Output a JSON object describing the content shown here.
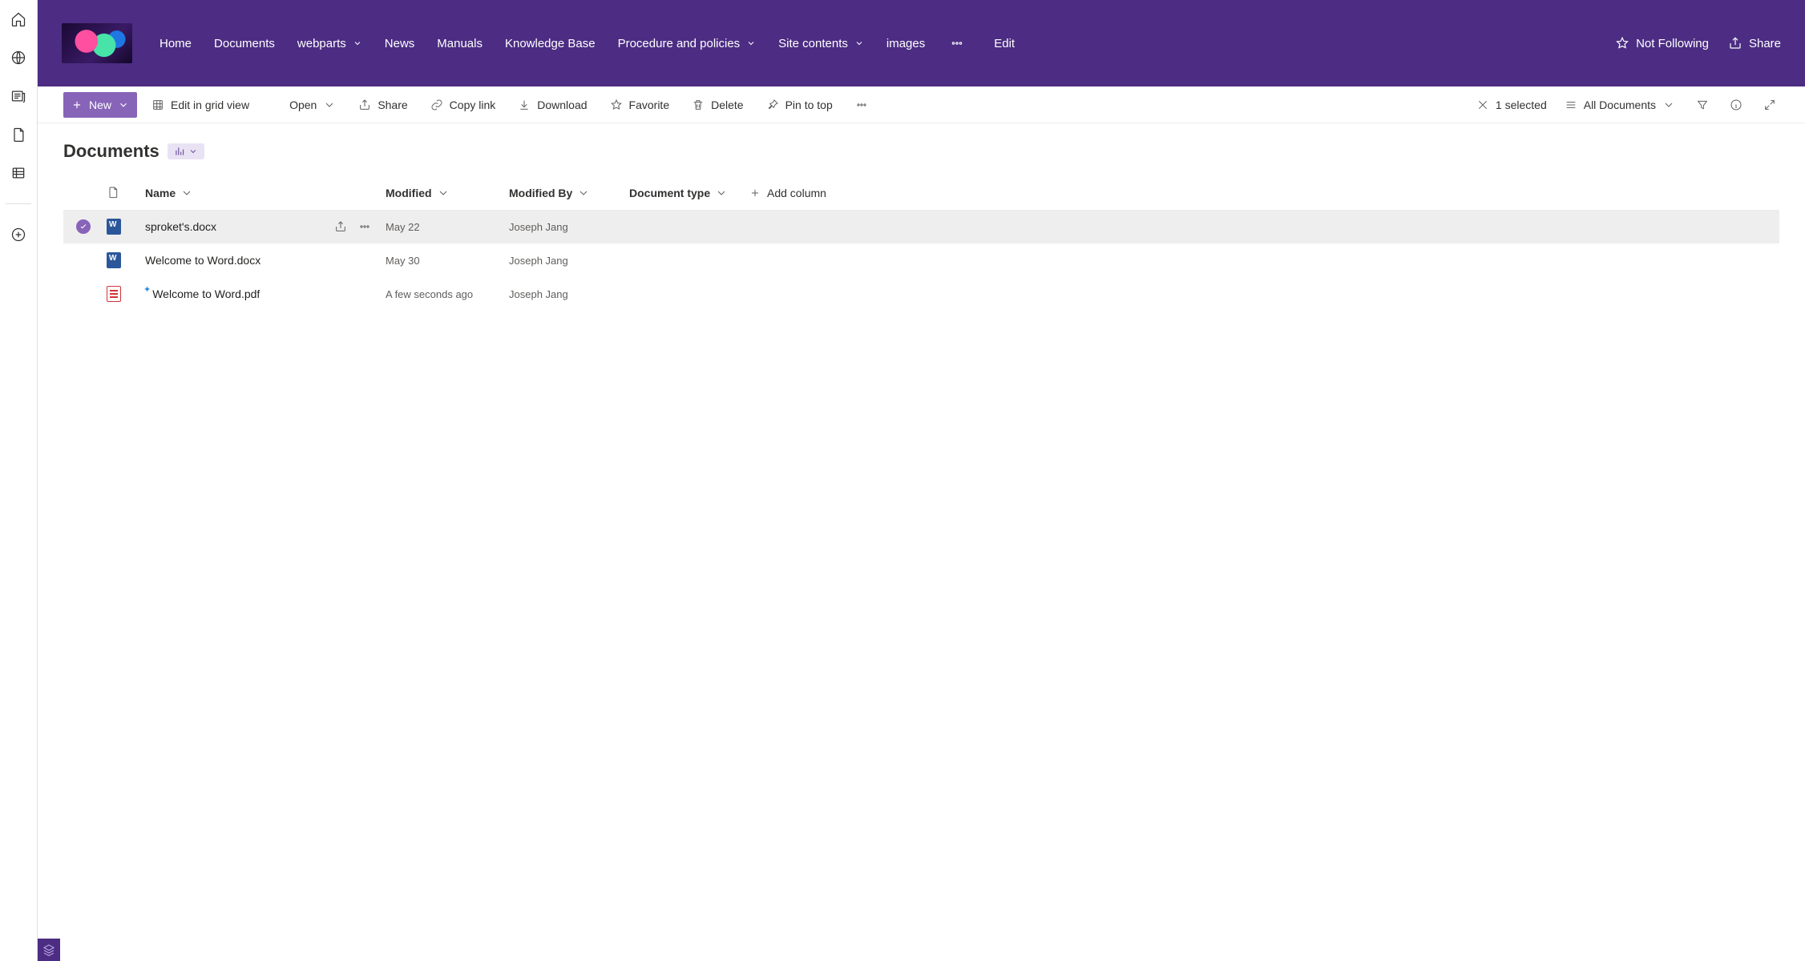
{
  "nav": {
    "links": [
      {
        "label": "Home",
        "dropdown": false
      },
      {
        "label": "Documents",
        "dropdown": false
      },
      {
        "label": "webparts",
        "dropdown": true
      },
      {
        "label": "News",
        "dropdown": false
      },
      {
        "label": "Manuals",
        "dropdown": false
      },
      {
        "label": "Knowledge Base",
        "dropdown": false
      },
      {
        "label": "Procedure and policies",
        "dropdown": true
      },
      {
        "label": "Site contents",
        "dropdown": true
      },
      {
        "label": "images",
        "dropdown": false
      }
    ],
    "edit": "Edit",
    "follow": "Not Following",
    "share": "Share"
  },
  "commands": {
    "new": "New",
    "edit_grid": "Edit in grid view",
    "open": "Open",
    "share": "Share",
    "copy_link": "Copy link",
    "download": "Download",
    "favorite": "Favorite",
    "delete": "Delete",
    "pin": "Pin to top",
    "selected": "1 selected",
    "view_name": "All Documents"
  },
  "page": {
    "title": "Documents",
    "columns": {
      "name": "Name",
      "modified": "Modified",
      "modified_by": "Modified By",
      "doc_type": "Document type",
      "add": "Add column"
    }
  },
  "rows": [
    {
      "selected": true,
      "type": "docx",
      "new": false,
      "name": "sproket's.docx",
      "modified": "May 22",
      "by": "Joseph Jang"
    },
    {
      "selected": false,
      "type": "docx",
      "new": false,
      "name": "Welcome to Word.docx",
      "modified": "May 30",
      "by": "Joseph Jang"
    },
    {
      "selected": false,
      "type": "pdf",
      "new": true,
      "name": "Welcome to Word.pdf",
      "modified": "A few seconds ago",
      "by": "Joseph Jang"
    }
  ]
}
